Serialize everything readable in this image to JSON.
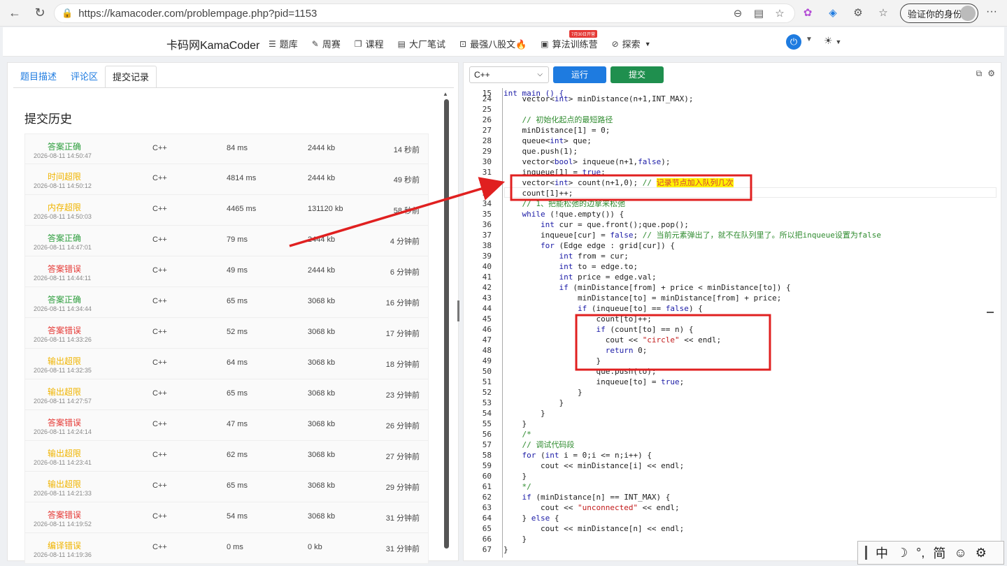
{
  "browser": {
    "url": "https://kamacoder.com/problempage.php?pid=1153",
    "profile_label": "验证你的身份"
  },
  "site": {
    "brand": "卡码网KamaCoder",
    "menu": [
      {
        "label": "题库",
        "icon": "list-icon"
      },
      {
        "label": "周赛",
        "icon": "pencil-icon"
      },
      {
        "label": "课程",
        "icon": "book-icon"
      },
      {
        "label": "大厂笔试",
        "icon": "document-icon"
      },
      {
        "label": "最强八股文🔥",
        "icon": "code-icon"
      },
      {
        "label": "算法训练营",
        "icon": "calendar-icon"
      },
      {
        "label": "探索",
        "icon": "compass-icon"
      }
    ],
    "camp_badge": "7月30日开营"
  },
  "left": {
    "tabs": [
      "题目描述",
      "评论区",
      "提交记录"
    ],
    "active_tab": "提交记录",
    "history_title": "提交历史",
    "submissions": [
      {
        "status": "答案正确",
        "kind": "ac",
        "time": "2026-08-11 14:50:47",
        "lang": "C++",
        "runtime": "84 ms",
        "mem": "2444 kb",
        "ago": "14 秒前"
      },
      {
        "status": "时间超限",
        "kind": "tle",
        "time": "2026-08-11 14:50:12",
        "lang": "C++",
        "runtime": "4814 ms",
        "mem": "2444 kb",
        "ago": "49 秒前"
      },
      {
        "status": "内存超限",
        "kind": "tle",
        "time": "2026-08-11 14:50:03",
        "lang": "C++",
        "runtime": "4465 ms",
        "mem": "131120 kb",
        "ago": "58 秒前"
      },
      {
        "status": "答案正确",
        "kind": "ac",
        "time": "2026-08-11 14:47:01",
        "lang": "C++",
        "runtime": "79 ms",
        "mem": "2444 kb",
        "ago": "4 分钟前"
      },
      {
        "status": "答案错误",
        "kind": "wa",
        "time": "2026-08-11 14:44:11",
        "lang": "C++",
        "runtime": "49 ms",
        "mem": "2444 kb",
        "ago": "6 分钟前"
      },
      {
        "status": "答案正确",
        "kind": "ac",
        "time": "2026-08-11 14:34:44",
        "lang": "C++",
        "runtime": "65 ms",
        "mem": "3068 kb",
        "ago": "16 分钟前"
      },
      {
        "status": "答案错误",
        "kind": "wa",
        "time": "2026-08-11 14:33:26",
        "lang": "C++",
        "runtime": "52 ms",
        "mem": "3068 kb",
        "ago": "17 分钟前"
      },
      {
        "status": "输出超限",
        "kind": "tle",
        "time": "2026-08-11 14:32:35",
        "lang": "C++",
        "runtime": "64 ms",
        "mem": "3068 kb",
        "ago": "18 分钟前"
      },
      {
        "status": "输出超限",
        "kind": "tle",
        "time": "2026-08-11 14:27:57",
        "lang": "C++",
        "runtime": "65 ms",
        "mem": "3068 kb",
        "ago": "23 分钟前"
      },
      {
        "status": "答案错误",
        "kind": "wa",
        "time": "2026-08-11 14:24:14",
        "lang": "C++",
        "runtime": "47 ms",
        "mem": "3068 kb",
        "ago": "26 分钟前"
      },
      {
        "status": "输出超限",
        "kind": "tle",
        "time": "2026-08-11 14:23:41",
        "lang": "C++",
        "runtime": "62 ms",
        "mem": "3068 kb",
        "ago": "27 分钟前"
      },
      {
        "status": "输出超限",
        "kind": "tle",
        "time": "2026-08-11 14:21:33",
        "lang": "C++",
        "runtime": "65 ms",
        "mem": "3068 kb",
        "ago": "29 分钟前"
      },
      {
        "status": "答案错误",
        "kind": "wa",
        "time": "2026-08-11 14:19:52",
        "lang": "C++",
        "runtime": "54 ms",
        "mem": "3068 kb",
        "ago": "31 分钟前"
      },
      {
        "status": "编译错误",
        "kind": "tle",
        "time": "2026-08-11 14:19:36",
        "lang": "C++",
        "runtime": "0 ms",
        "mem": "0 kb",
        "ago": "31 分钟前"
      }
    ]
  },
  "editor": {
    "language": "C++",
    "run_label": "运行",
    "submit_label": "提交",
    "sticky_line": {
      "n": 15,
      "text": "int main () {"
    },
    "lines": [
      {
        "n": 24,
        "text": "    vector<int> minDistance(n+1,INT_MAX);"
      },
      {
        "n": 25,
        "text": ""
      },
      {
        "n": 26,
        "text": "    // 初始化起点的最短路径"
      },
      {
        "n": 27,
        "text": "    minDistance[1] = 0;"
      },
      {
        "n": 28,
        "text": "    queue<int> que;"
      },
      {
        "n": 29,
        "text": "    que.push(1);"
      },
      {
        "n": 30,
        "text": "    vector<bool> inqueue(n+1,false);"
      },
      {
        "n": 31,
        "text": "    inqueue[1] = true;"
      },
      {
        "n": 32,
        "text": "    vector<int> count(n+1,0); // 记录节点加入队列几次"
      },
      {
        "n": 33,
        "text": "    count[1]++;"
      },
      {
        "n": 34,
        "text": "    // 1、把能松弛的边拿来松弛"
      },
      {
        "n": 35,
        "text": "    while (!que.empty()) {"
      },
      {
        "n": 36,
        "text": "        int cur = que.front();que.pop();"
      },
      {
        "n": 37,
        "text": "        inqueue[cur] = false; // 当前元素弹出了，就不在队列里了。所以把inqueue设置为false"
      },
      {
        "n": 38,
        "text": "        for (Edge edge : grid[cur]) {"
      },
      {
        "n": 39,
        "text": "            int from = cur;"
      },
      {
        "n": 40,
        "text": "            int to = edge.to;"
      },
      {
        "n": 41,
        "text": "            int price = edge.val;"
      },
      {
        "n": 42,
        "text": "            if (minDistance[from] + price < minDistance[to]) {"
      },
      {
        "n": 43,
        "text": "                minDistance[to] = minDistance[from] + price;"
      },
      {
        "n": 44,
        "text": "                if (inqueue[to] == false) {"
      },
      {
        "n": 45,
        "text": "                    count[to]++;"
      },
      {
        "n": 46,
        "text": "                    if (count[to] == n) {"
      },
      {
        "n": 47,
        "text": "                      cout << \"circle\" << endl;"
      },
      {
        "n": 48,
        "text": "                      return 0;"
      },
      {
        "n": 49,
        "text": "                    }"
      },
      {
        "n": 50,
        "text": "                    que.push(to);"
      },
      {
        "n": 51,
        "text": "                    inqueue[to] = true;"
      },
      {
        "n": 52,
        "text": "                }"
      },
      {
        "n": 53,
        "text": "            }"
      },
      {
        "n": 54,
        "text": "        }"
      },
      {
        "n": 55,
        "text": "    }"
      },
      {
        "n": 56,
        "text": "    /*"
      },
      {
        "n": 57,
        "text": "    // 调试代码段"
      },
      {
        "n": 58,
        "text": "    for (int i = 0;i <= n;i++) {"
      },
      {
        "n": 59,
        "text": "        cout << minDistance[i] << endl;"
      },
      {
        "n": 60,
        "text": "    }"
      },
      {
        "n": 61,
        "text": "    */"
      },
      {
        "n": 62,
        "text": "    if (minDistance[n] == INT_MAX) {"
      },
      {
        "n": 63,
        "text": "        cout << \"unconnected\" << endl;"
      },
      {
        "n": 64,
        "text": "    } else {"
      },
      {
        "n": 65,
        "text": "        cout << minDistance[n] << endl;"
      },
      {
        "n": 66,
        "text": "    }"
      },
      {
        "n": 67,
        "text": "}"
      }
    ]
  },
  "ime": {
    "mode": "中",
    "moon": "☽",
    "punct": "°,",
    "script": "简",
    "emoji": "☺",
    "gear": "⚙"
  },
  "colors": {
    "accent": "#1e7be0",
    "submit": "#1f8f4e",
    "annotation": "#e02020",
    "ac": "#2e9e3e",
    "tle": "#f0b400",
    "wa": "#e53935"
  }
}
